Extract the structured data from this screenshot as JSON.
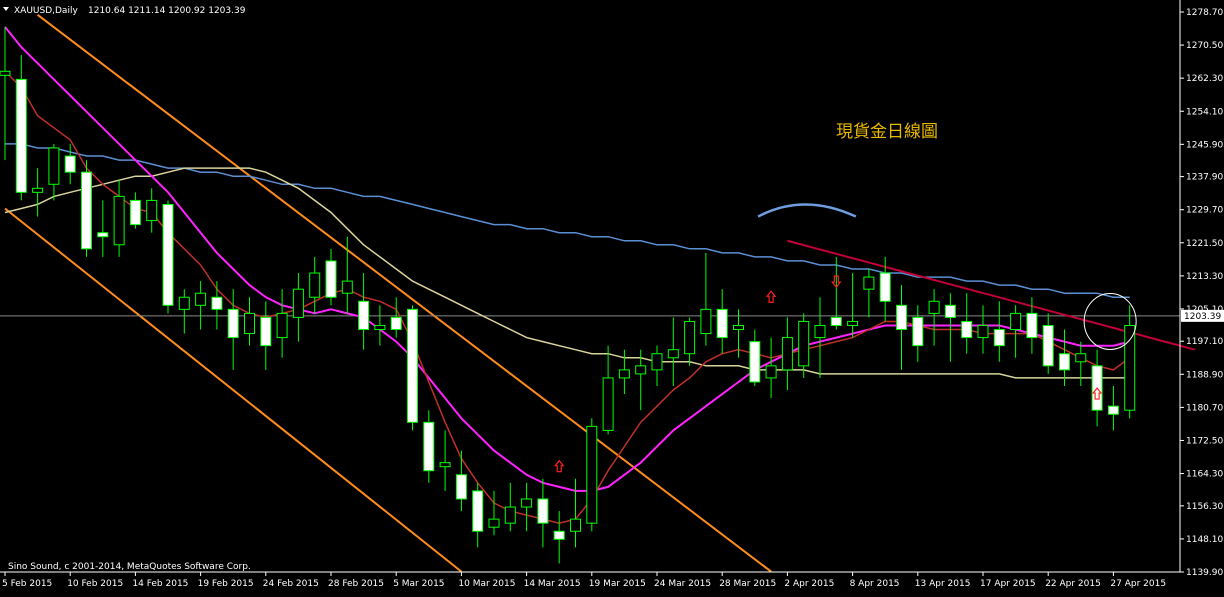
{
  "header": {
    "symbol": "XAUUSD,Daily",
    "ohlc": "1210.64 1211.14 1200.92 1203.39"
  },
  "footer": {
    "copyright": "Sino Sound, c 2001-2014, MetaQuotes Software Corp."
  },
  "annotation": {
    "text": "現貨金日線圖"
  },
  "colors": {
    "background": "#000000",
    "up_candle": "#000000",
    "down_candle": "#ffffff",
    "wick": "#00ff00",
    "candle_border": "#00ff00",
    "ma_fast": "#c0302a",
    "ma_mid": "#ff22ff",
    "ma_slow": "#d8d49a",
    "ma_long": "#5b8fd4",
    "channel": "#ff8c1a",
    "trendline": "#c00038",
    "arrow": "#ff2020",
    "circle": "#ffffff",
    "arc": "#6f9ee0"
  },
  "chart_data": {
    "type": "candlestick",
    "symbol": "XAUUSD",
    "timeframe": "Daily",
    "y_ticks": [
      "1278.70",
      "1270.50",
      "1262.30",
      "1254.10",
      "1245.90",
      "1237.90",
      "1229.70",
      "1221.50",
      "1213.30",
      "1205.10",
      "1197.10",
      "1188.90",
      "1180.70",
      "1172.50",
      "1164.30",
      "1156.30",
      "1148.10",
      "1139.90"
    ],
    "ylim": [
      1139.9,
      1278.7
    ],
    "current_price": "1203.39",
    "x_ticks": [
      {
        "i": 0,
        "label": "5 Feb 2015"
      },
      {
        "i": 4,
        "label": "10 Feb 2015"
      },
      {
        "i": 8,
        "label": "14 Feb 2015"
      },
      {
        "i": 12,
        "label": "19 Feb 2015"
      },
      {
        "i": 16,
        "label": "24 Feb 2015"
      },
      {
        "i": 20,
        "label": "28 Feb 2015"
      },
      {
        "i": 24,
        "label": "5 Mar 2015"
      },
      {
        "i": 28,
        "label": "10 Mar 2015"
      },
      {
        "i": 32,
        "label": "14 Mar 2015"
      },
      {
        "i": 36,
        "label": "19 Mar 2015"
      },
      {
        "i": 40,
        "label": "24 Mar 2015"
      },
      {
        "i": 44,
        "label": "28 Mar 2015"
      },
      {
        "i": 48,
        "label": "2 Apr 2015"
      },
      {
        "i": 52,
        "label": "8 Apr 2015"
      },
      {
        "i": 56,
        "label": "13 Apr 2015"
      },
      {
        "i": 60,
        "label": "17 Apr 2015"
      },
      {
        "i": 64,
        "label": "22 Apr 2015"
      },
      {
        "i": 68,
        "label": "27 Apr 2015"
      }
    ],
    "candles": [
      {
        "o": 1263,
        "h": 1275,
        "l": 1242,
        "c": 1264
      },
      {
        "o": 1262,
        "h": 1268,
        "l": 1232,
        "c": 1234
      },
      {
        "o": 1234,
        "h": 1240,
        "l": 1228,
        "c": 1235
      },
      {
        "o": 1236,
        "h": 1246,
        "l": 1232,
        "c": 1245
      },
      {
        "o": 1243,
        "h": 1246,
        "l": 1236,
        "c": 1239
      },
      {
        "o": 1239,
        "h": 1242,
        "l": 1218,
        "c": 1220
      },
      {
        "o": 1224,
        "h": 1232,
        "l": 1218,
        "c": 1223
      },
      {
        "o": 1221,
        "h": 1237,
        "l": 1218,
        "c": 1233
      },
      {
        "o": 1232,
        "h": 1234,
        "l": 1225,
        "c": 1226
      },
      {
        "o": 1227,
        "h": 1235,
        "l": 1224,
        "c": 1232
      },
      {
        "o": 1231,
        "h": 1232,
        "l": 1204,
        "c": 1206
      },
      {
        "o": 1205,
        "h": 1210,
        "l": 1199,
        "c": 1208
      },
      {
        "o": 1206,
        "h": 1212,
        "l": 1200,
        "c": 1209
      },
      {
        "o": 1208,
        "h": 1212,
        "l": 1200,
        "c": 1205
      },
      {
        "o": 1205,
        "h": 1210,
        "l": 1190,
        "c": 1198
      },
      {
        "o": 1199,
        "h": 1208,
        "l": 1196,
        "c": 1204
      },
      {
        "o": 1203,
        "h": 1207,
        "l": 1190,
        "c": 1196
      },
      {
        "o": 1198,
        "h": 1210,
        "l": 1193,
        "c": 1204
      },
      {
        "o": 1203,
        "h": 1214,
        "l": 1197,
        "c": 1210
      },
      {
        "o": 1208,
        "h": 1218,
        "l": 1204,
        "c": 1214
      },
      {
        "o": 1217,
        "h": 1220,
        "l": 1206,
        "c": 1208
      },
      {
        "o": 1209,
        "h": 1223,
        "l": 1204,
        "c": 1212
      },
      {
        "o": 1207,
        "h": 1214,
        "l": 1195,
        "c": 1200
      },
      {
        "o": 1200,
        "h": 1206,
        "l": 1196,
        "c": 1201
      },
      {
        "o": 1203,
        "h": 1208,
        "l": 1198,
        "c": 1200
      },
      {
        "o": 1205,
        "h": 1206,
        "l": 1175,
        "c": 1177
      },
      {
        "o": 1177,
        "h": 1180,
        "l": 1162,
        "c": 1165
      },
      {
        "o": 1166,
        "h": 1175,
        "l": 1160,
        "c": 1167
      },
      {
        "o": 1164,
        "h": 1170,
        "l": 1155,
        "c": 1158
      },
      {
        "o": 1160,
        "h": 1162,
        "l": 1146,
        "c": 1150
      },
      {
        "o": 1151,
        "h": 1160,
        "l": 1149,
        "c": 1153
      },
      {
        "o": 1152,
        "h": 1162,
        "l": 1150,
        "c": 1156
      },
      {
        "o": 1156,
        "h": 1162,
        "l": 1150,
        "c": 1158
      },
      {
        "o": 1158,
        "h": 1163,
        "l": 1146,
        "c": 1152
      },
      {
        "o": 1150,
        "h": 1155,
        "l": 1142,
        "c": 1148
      },
      {
        "o": 1150,
        "h": 1163,
        "l": 1146,
        "c": 1153
      },
      {
        "o": 1152,
        "h": 1178,
        "l": 1150,
        "c": 1176
      },
      {
        "o": 1175,
        "h": 1196,
        "l": 1174,
        "c": 1188
      },
      {
        "o": 1188,
        "h": 1195,
        "l": 1184,
        "c": 1190
      },
      {
        "o": 1189,
        "h": 1195,
        "l": 1180,
        "c": 1191
      },
      {
        "o": 1190,
        "h": 1196,
        "l": 1186,
        "c": 1194
      },
      {
        "o": 1193,
        "h": 1203,
        "l": 1186,
        "c": 1195
      },
      {
        "o": 1194,
        "h": 1203,
        "l": 1191,
        "c": 1202
      },
      {
        "o": 1199,
        "h": 1219,
        "l": 1196,
        "c": 1205
      },
      {
        "o": 1205,
        "h": 1210,
        "l": 1194,
        "c": 1198
      },
      {
        "o": 1200,
        "h": 1205,
        "l": 1193,
        "c": 1201
      },
      {
        "o": 1197,
        "h": 1200,
        "l": 1186,
        "c": 1187
      },
      {
        "o": 1188,
        "h": 1198,
        "l": 1183,
        "c": 1191
      },
      {
        "o": 1190,
        "h": 1203,
        "l": 1185,
        "c": 1198
      },
      {
        "o": 1191,
        "h": 1204,
        "l": 1188,
        "c": 1202
      },
      {
        "o": 1198,
        "h": 1208,
        "l": 1188,
        "c": 1201
      },
      {
        "o": 1203,
        "h": 1218,
        "l": 1200,
        "c": 1201
      },
      {
        "o": 1201,
        "h": 1214,
        "l": 1198,
        "c": 1202
      },
      {
        "o": 1210,
        "h": 1215,
        "l": 1203,
        "c": 1213
      },
      {
        "o": 1214,
        "h": 1218,
        "l": 1202,
        "c": 1207
      },
      {
        "o": 1206,
        "h": 1211,
        "l": 1190,
        "c": 1200
      },
      {
        "o": 1203,
        "h": 1206,
        "l": 1192,
        "c": 1196
      },
      {
        "o": 1204,
        "h": 1210,
        "l": 1196,
        "c": 1207
      },
      {
        "o": 1206,
        "h": 1209,
        "l": 1192,
        "c": 1203
      },
      {
        "o": 1202,
        "h": 1209,
        "l": 1194,
        "c": 1198
      },
      {
        "o": 1198,
        "h": 1206,
        "l": 1194,
        "c": 1201
      },
      {
        "o": 1200,
        "h": 1207,
        "l": 1192,
        "c": 1196
      },
      {
        "o": 1200,
        "h": 1206,
        "l": 1193,
        "c": 1204
      },
      {
        "o": 1204,
        "h": 1208,
        "l": 1194,
        "c": 1198
      },
      {
        "o": 1201,
        "h": 1204,
        "l": 1189,
        "c": 1191
      },
      {
        "o": 1194,
        "h": 1200,
        "l": 1186,
        "c": 1190
      },
      {
        "o": 1192,
        "h": 1197,
        "l": 1186,
        "c": 1194
      },
      {
        "o": 1191,
        "h": 1195,
        "l": 1176,
        "c": 1180
      },
      {
        "o": 1181,
        "h": 1186,
        "l": 1175,
        "c": 1179
      },
      {
        "o": 1180,
        "h": 1206,
        "l": 1178,
        "c": 1201
      }
    ],
    "ma_fast": [
      1264,
      1260,
      1253,
      1250,
      1247,
      1240,
      1236,
      1233,
      1230,
      1229,
      1224,
      1220,
      1216,
      1210,
      1206,
      1204,
      1203,
      1204,
      1205,
      1207,
      1209,
      1210,
      1208,
      1207,
      1205,
      1197,
      1187,
      1177,
      1168,
      1162,
      1157,
      1155,
      1154,
      1153,
      1152,
      1153,
      1158,
      1165,
      1171,
      1177,
      1181,
      1185,
      1188,
      1192,
      1194,
      1195,
      1194,
      1193,
      1194,
      1195,
      1196,
      1197,
      1198,
      1200,
      1202,
      1202,
      1201,
      1200,
      1200,
      1200,
      1199,
      1199,
      1199,
      1199,
      1197,
      1195,
      1193,
      1191,
      1190,
      1193
    ],
    "ma_mid": [
      1275,
      1270,
      1266,
      1262,
      1258,
      1254,
      1250,
      1246,
      1242,
      1238,
      1234,
      1229,
      1224,
      1219,
      1215,
      1211,
      1208,
      1206,
      1205,
      1204,
      1205,
      1204,
      1203,
      1200,
      1197,
      1193,
      1188,
      1183,
      1178,
      1174,
      1170,
      1167,
      1164,
      1162,
      1161,
      1160,
      1160,
      1161,
      1164,
      1167,
      1171,
      1175,
      1178,
      1181,
      1184,
      1187,
      1190,
      1192,
      1194,
      1196,
      1197,
      1198,
      1199,
      1200,
      1201,
      1201,
      1201,
      1201,
      1201,
      1201,
      1201,
      1201,
      1200,
      1199,
      1198,
      1197,
      1196,
      1196,
      1196,
      1197
    ],
    "ma_slow": [
      1229,
      1230,
      1231,
      1233,
      1234,
      1235,
      1236,
      1237,
      1238,
      1238,
      1239,
      1240,
      1240,
      1240,
      1240,
      1240,
      1239,
      1237,
      1235,
      1232,
      1229,
      1225,
      1221,
      1218,
      1215,
      1212,
      1210,
      1208,
      1206,
      1204,
      1202,
      1200,
      1198,
      1197,
      1196,
      1195,
      1194,
      1194,
      1193,
      1193,
      1192,
      1192,
      1192,
      1191,
      1191,
      1191,
      1190,
      1190,
      1190,
      1190,
      1189,
      1189,
      1189,
      1189,
      1189,
      1189,
      1189,
      1189,
      1189,
      1189,
      1189,
      1189,
      1188,
      1188,
      1188,
      1188,
      1188,
      1188,
      1188,
      1188
    ],
    "ma_long": [
      1246,
      1246,
      1245,
      1245,
      1244,
      1243,
      1243,
      1242,
      1242,
      1241,
      1240,
      1240,
      1239,
      1239,
      1238,
      1238,
      1237,
      1236,
      1236,
      1235,
      1235,
      1234,
      1233,
      1233,
      1232,
      1231,
      1230,
      1229,
      1228,
      1227,
      1226,
      1226,
      1225,
      1225,
      1224,
      1224,
      1223,
      1223,
      1222,
      1222,
      1221,
      1221,
      1220,
      1220,
      1219,
      1219,
      1218,
      1218,
      1217,
      1217,
      1216,
      1216,
      1215,
      1215,
      1214,
      1214,
      1213,
      1213,
      1213,
      1212,
      1212,
      1211,
      1211,
      1210,
      1210,
      1209,
      1209,
      1209,
      1208,
      1208
    ],
    "trendline": {
      "start": {
        "i": 48,
        "price": 1222
      },
      "end": {
        "i": 73,
        "price": 1195
      }
    },
    "channel_upper": {
      "start": {
        "i": 2,
        "price": 1278
      },
      "end": {
        "i": 47,
        "price": 1140
      }
    },
    "channel_lower": {
      "start": {
        "i": 0,
        "price": 1230
      },
      "end": {
        "i": 28,
        "price": 1140
      }
    },
    "arrows": [
      {
        "i": 34,
        "price": 1166,
        "dir": "up"
      },
      {
        "i": 47,
        "price": 1208,
        "dir": "up"
      },
      {
        "i": 51,
        "price": 1212,
        "dir": "down"
      },
      {
        "i": 67,
        "price": 1184,
        "dir": "up"
      }
    ]
  }
}
